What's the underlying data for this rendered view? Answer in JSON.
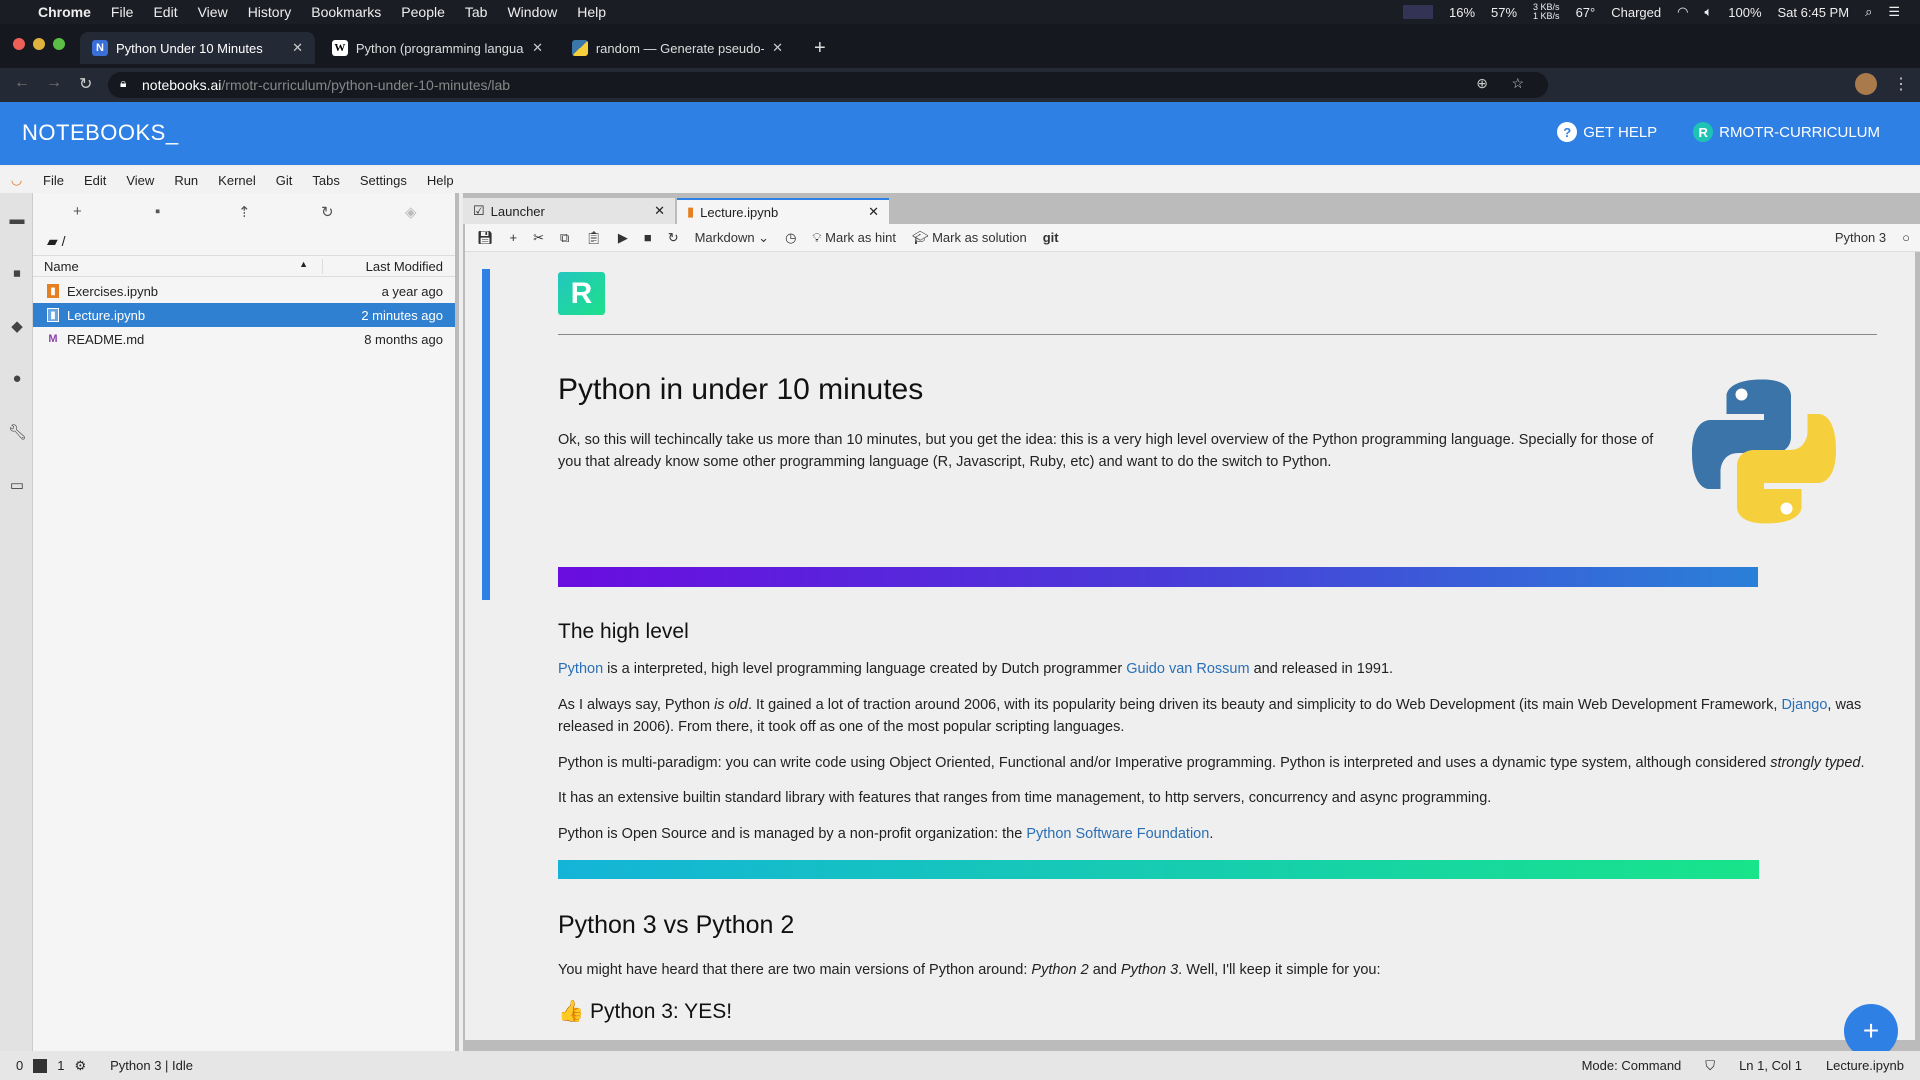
{
  "mac_menubar": {
    "app": "Chrome",
    "items": [
      "File",
      "Edit",
      "View",
      "History",
      "Bookmarks",
      "People",
      "Tab",
      "Window",
      "Help"
    ],
    "status": {
      "cpu": "16%",
      "mem": "57%",
      "net_up": "3 KB/s",
      "net_down": "1 KB/s",
      "temp": "67°",
      "battery_state": "Charged",
      "battery": "100%",
      "clock": "Sat 6:45 PM"
    }
  },
  "browser": {
    "tabs": [
      {
        "label": "Python Under 10 Minutes",
        "favicon": "N",
        "active": true
      },
      {
        "label": "Python (programming language)",
        "favicon": "W"
      },
      {
        "label": "random — Generate pseudo-ran",
        "favicon": "py"
      }
    ],
    "url_host": "notebooks.ai",
    "url_path": "/rmotr-curriculum/python-under-10-minutes/lab"
  },
  "header": {
    "logo": "NOTEBOOKS_",
    "get_help": "GET HELP",
    "account_initial": "R",
    "account": "RMOTR-CURRICULUM",
    "color": "#2f80e5"
  },
  "menu": [
    "File",
    "Edit",
    "View",
    "Run",
    "Kernel",
    "Git",
    "Tabs",
    "Settings",
    "Help"
  ],
  "file_browser": {
    "path": "/",
    "columns": {
      "name": "Name",
      "modified": "Last Modified"
    },
    "files": [
      {
        "name": "Exercises.ipynb",
        "modified": "a year ago",
        "type": "notebook"
      },
      {
        "name": "Lecture.ipynb",
        "modified": "2 minutes ago",
        "type": "notebook",
        "selected": true
      },
      {
        "name": "README.md",
        "modified": "8 months ago",
        "type": "markdown"
      }
    ]
  },
  "doc_tabs": [
    {
      "label": "Launcher"
    },
    {
      "label": "Lecture.ipynb",
      "active": true
    }
  ],
  "toolbar": {
    "cell_type": "Markdown",
    "mark_hint": "Mark as hint",
    "mark_solution": "Mark as solution",
    "git": "git",
    "kernel": "Python 3"
  },
  "notebook": {
    "logo_letter": "R",
    "title": "Python in under 10 minutes",
    "intro": "Ok, so this will techincally take us more than 10 minutes, but you get the idea: this is a very high level overview of the Python programming language. Specially for those of you that already know some other programming language (R, Javascript, Ruby, etc) and want to do the switch to Python.",
    "h_high": "The high level",
    "p1": {
      "link1": "Python",
      "t1": " is a interpreted, high level programming language created by Dutch programmer ",
      "link2": "Guido van Rossum",
      "t2": " and released in 1991."
    },
    "p2": {
      "t1": "As I always say, Python ",
      "em": "is old",
      "t2": ". It gained a lot of traction around 2006, with its popularity being driven its beauty and simplicity to do Web Development (its main Web Development Framework, ",
      "link": "Django",
      "t3": ", was released in 2006). From there, it took off as one of the most popular scripting languages."
    },
    "p3": {
      "t1": "Python is multi-paradigm: you can write code using Object Oriented, Functional and/or Imperative programming. Python is interpreted and uses a dynamic type system, although considered ",
      "em": "strongly typed",
      "t2": "."
    },
    "p4": "It has an extensive builtin standard library with features that ranges from time management, to http servers, concurrency and async programming.",
    "p5": {
      "t1": "Python is Open Source and is managed by a non-profit organization: the ",
      "link": "Python Software Foundation",
      "t2": "."
    },
    "h_vs": "Python 3 vs Python 2",
    "p6": {
      "t1": "You might have heard that there are two main versions of Python around: ",
      "em1": "Python 2",
      "t2": " and ",
      "em2": "Python 3",
      "t3": ". Well, I'll keep it simple for you:"
    },
    "h_yes_emoji": "👍",
    "h_yes": "Python 3: YES!"
  },
  "statusbar": {
    "count0": "0",
    "count1": "1",
    "kernel": "Python 3 | Idle",
    "mode": "Mode: Command",
    "position": "Ln 1, Col 1",
    "file": "Lecture.ipynb"
  }
}
